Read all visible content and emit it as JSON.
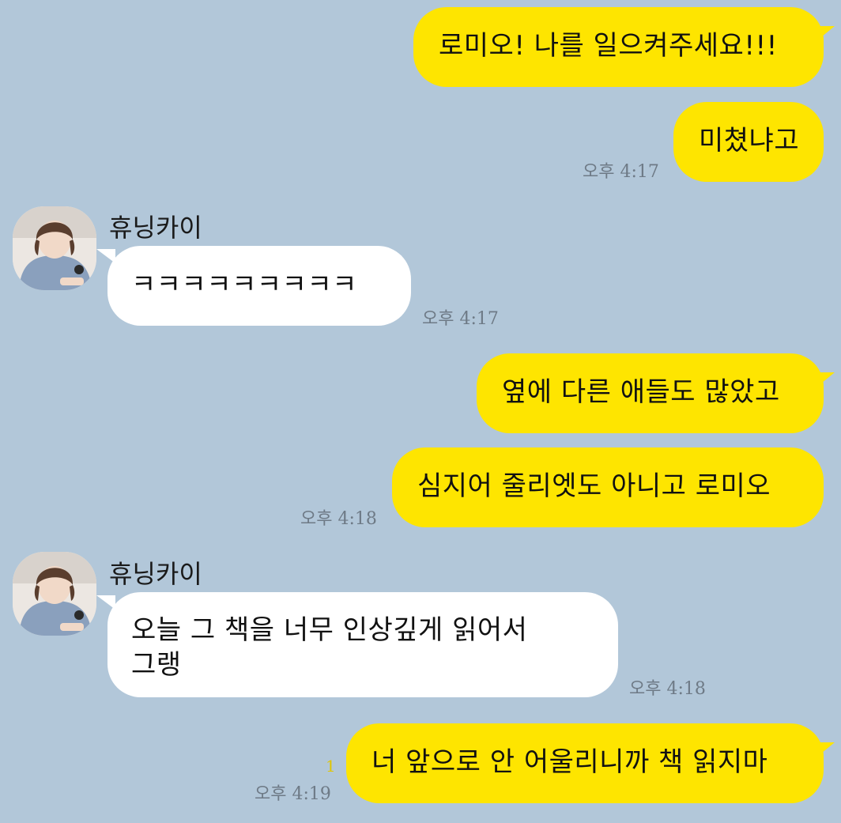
{
  "colors": {
    "background": "#b2c7d9",
    "my_bubble": "#fee500",
    "their_bubble": "#ffffff",
    "timestamp": "#6e7a86",
    "unread_count": "#e0c600"
  },
  "contact": {
    "name": "휴닝카이",
    "avatar_icon": "profile-photo"
  },
  "messages": [
    {
      "from": "me",
      "text": "로미오! 나를 일으켜주세요!!!"
    },
    {
      "from": "me",
      "text": "미쳤냐고",
      "time": "오후 4:17"
    },
    {
      "from": "other",
      "sender": "휴닝카이",
      "text": "ㅋㅋㅋㅋㅋㅋㅋㅋㅋ",
      "time": "오후 4:17"
    },
    {
      "from": "me",
      "text": "옆에 다른 애들도 많았고"
    },
    {
      "from": "me",
      "text": "심지어 줄리엣도 아니고 로미오",
      "time": "오후 4:18"
    },
    {
      "from": "other",
      "sender": "휴닝카이",
      "line1": "오늘 그 책을 너무 인상깊게 읽어서",
      "line2": "그랭",
      "time": "오후 4:18"
    },
    {
      "from": "me",
      "text": "너 앞으로 안 어울리니까 책 읽지마",
      "unread": "1",
      "time": "오후 4:19"
    }
  ]
}
